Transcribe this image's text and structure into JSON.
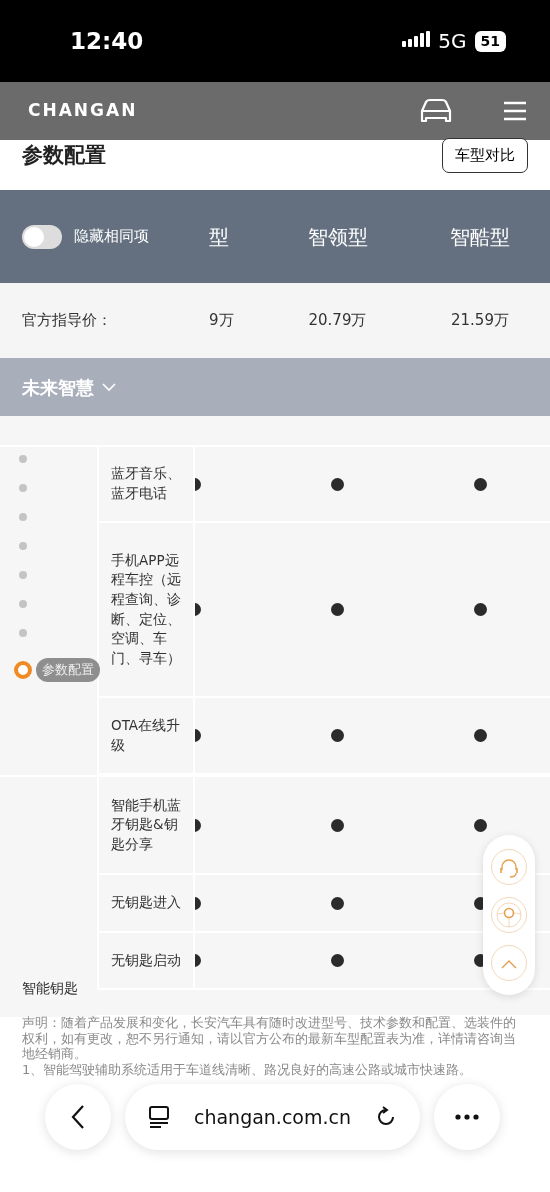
{
  "status_bar": {
    "time": "12:40",
    "network": "5G",
    "battery": "51"
  },
  "header": {
    "brand": "CHANGAN"
  },
  "page_title": "参数配置",
  "compare_button": "车型对比",
  "compare_header": {
    "toggle": {
      "label": "隐藏相同项",
      "on": false
    },
    "models": [
      "型",
      "智领型",
      "智酷型"
    ]
  },
  "price_row": {
    "label": "官方指导价：",
    "prices": [
      "9万",
      "20.79万",
      "21.59万"
    ]
  },
  "section": {
    "title": "未来智慧",
    "expanded": true
  },
  "groups": [
    {
      "rows": [
        {
          "feature": "蓝牙音乐、蓝牙电话",
          "values": [
            true,
            true,
            true
          ]
        },
        {
          "feature": "手机APP远程车控（远程查询、诊断、定位、空调、车门、寻车）",
          "values": [
            true,
            true,
            true
          ]
        },
        {
          "feature": "OTA在线升级",
          "values": [
            true,
            true,
            true
          ]
        }
      ]
    },
    {
      "label": "智能钥匙",
      "rows": [
        {
          "feature": "智能手机蓝牙钥匙&钥匙分享",
          "values": [
            true,
            true,
            true
          ]
        },
        {
          "feature": "无钥匙进入",
          "values": [
            true,
            true,
            true
          ]
        },
        {
          "feature": "无钥匙启动",
          "values": [
            true,
            true,
            true
          ]
        }
      ]
    }
  ],
  "side_nav": {
    "items": [
      {
        "selected": false
      },
      {
        "selected": false
      },
      {
        "selected": false
      },
      {
        "selected": false
      },
      {
        "selected": false
      },
      {
        "selected": false
      },
      {
        "selected": false
      },
      {
        "selected": true,
        "label": "参数配置"
      }
    ]
  },
  "disclaimer": [
    "声明：随着产品发展和变化，长安汽车具有随时改进型号、技术参数和配置、选装件的权利，如有更改，恕不另行通知，请以官方公布的最新车型配置表为准，详情请咨询当地经销商。",
    "1、智能驾驶辅助系统适用于车道线清晰、路况良好的高速公路或城市快速路。"
  ],
  "browser": {
    "url": "changan.com.cn"
  }
}
